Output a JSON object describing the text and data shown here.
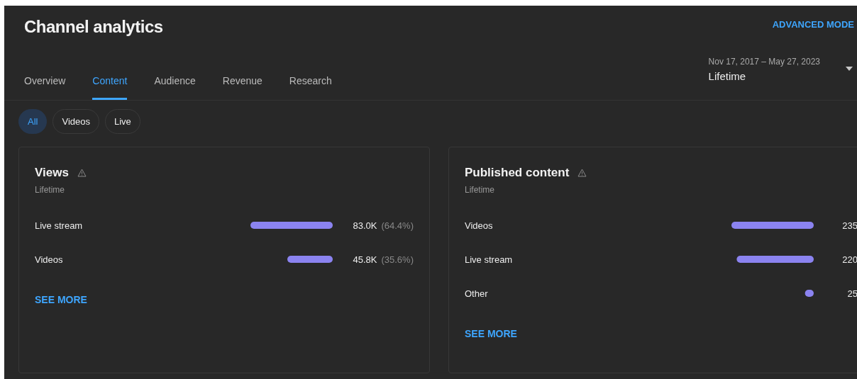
{
  "header": {
    "title": "Channel analytics",
    "advanced_mode": "ADVANCED MODE"
  },
  "tabs": [
    {
      "label": "Overview",
      "selected": false
    },
    {
      "label": "Content",
      "selected": true
    },
    {
      "label": "Audience",
      "selected": false
    },
    {
      "label": "Revenue",
      "selected": false
    },
    {
      "label": "Research",
      "selected": false
    }
  ],
  "date_range": {
    "range": "Nov 17, 2017 – May 27, 2023",
    "period": "Lifetime"
  },
  "filters": [
    {
      "label": "All",
      "selected": true
    },
    {
      "label": "Videos",
      "selected": false
    },
    {
      "label": "Live",
      "selected": false
    }
  ],
  "cards": [
    {
      "title": "Views",
      "subtitle": "Lifetime",
      "chart_data": {
        "type": "bar",
        "orientation": "horizontal",
        "categories": [
          "Live stream",
          "Videos"
        ],
        "values": [
          83000,
          45800
        ],
        "data_labels": true,
        "value_labels": [
          "83.0K",
          "45.8K"
        ]
      },
      "percents": [
        "(64.4%)",
        "(35.6%)"
      ],
      "see_more": "SEE MORE"
    },
    {
      "title": "Published content",
      "subtitle": "Lifetime",
      "chart_data": {
        "type": "bar",
        "orientation": "horizontal",
        "categories": [
          "Videos",
          "Live stream",
          "Other"
        ],
        "values": [
          235,
          220,
          25
        ],
        "data_labels": true,
        "value_labels": [
          "235",
          "220",
          "25"
        ]
      },
      "see_more": "SEE MORE"
    }
  ]
}
